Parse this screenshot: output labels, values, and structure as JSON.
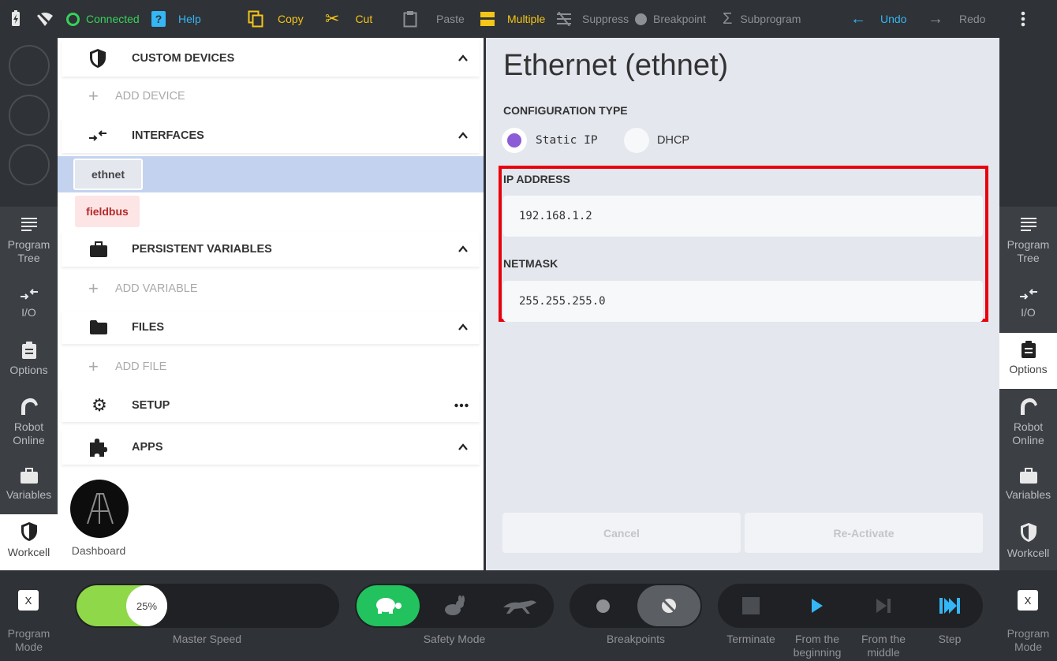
{
  "toolbar": {
    "status": "Connected",
    "help": "Help",
    "copy": "Copy",
    "cut": "Cut",
    "paste": "Paste",
    "multiple": "Multiple",
    "suppress": "Suppress",
    "breakpoint": "Breakpoint",
    "subprogram": "Subprogram",
    "undo": "Undo",
    "redo": "Redo"
  },
  "left_nav": [
    "Program Tree",
    "I/O",
    "Options",
    "Robot Online",
    "Variables",
    "Workcell"
  ],
  "right_nav": [
    "Program Tree",
    "I/O",
    "Options",
    "Robot Online",
    "Variables",
    "Workcell"
  ],
  "left_nav_selected": "Workcell",
  "right_nav_selected": "Options",
  "tree": {
    "custom_devices": {
      "title": "CUSTOM DEVICES",
      "add": "ADD DEVICE"
    },
    "interfaces": {
      "title": "INTERFACES",
      "items": [
        "ethnet",
        "fieldbus"
      ],
      "selected": "ethnet"
    },
    "persistent_variables": {
      "title": "PERSISTENT VARIABLES",
      "add": "ADD VARIABLE"
    },
    "files": {
      "title": "FILES",
      "add": "ADD FILE"
    },
    "setup": {
      "title": "SETUP"
    },
    "apps": {
      "title": "APPS",
      "items": [
        "Dashboard"
      ]
    }
  },
  "detail": {
    "title": "Ethernet (ethnet)",
    "config_type_label": "CONFIGURATION TYPE",
    "options": [
      "Static IP",
      "DHCP"
    ],
    "selected_option": "Static IP",
    "ip_label": "IP ADDRESS",
    "ip_value": "192.168.1.2",
    "netmask_label": "NETMASK",
    "netmask_value": "255.255.255.0",
    "cancel": "Cancel",
    "reactivate": "Re-Activate"
  },
  "bottom": {
    "program_mode_left": "Program Mode",
    "program_mode_right": "Program Mode",
    "mode_icon_text": "X",
    "speed_value": "25%",
    "speed_fraction": 0.25,
    "master_speed": "Master Speed",
    "safety_mode": "Safety Mode",
    "breakpoints": "Breakpoints",
    "terminate": "Terminate",
    "from_beginning": "From the beginning",
    "from_middle": "From the middle",
    "step": "Step"
  },
  "colors": {
    "accent_yellow": "#f5c518",
    "connected_green": "#35d35a",
    "undo_blue": "#35b6f5",
    "speed_green": "#8fd84a",
    "safety_green": "#22c35e",
    "selection_blue": "#c3d3ef",
    "radio_purple": "#8b5cd6",
    "highlight_red": "#e8000d"
  }
}
